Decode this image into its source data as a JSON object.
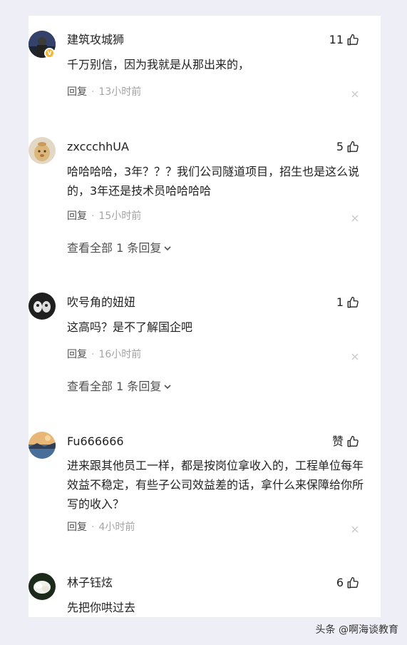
{
  "comments": [
    {
      "username": "建筑攻城狮",
      "likes": "11",
      "text": "千万别信，因为我就是从那出来的，",
      "reply_label": "回复",
      "separator": "·",
      "time": "13小时前",
      "badge": "V"
    },
    {
      "username": "zxccchhUA",
      "likes": "5",
      "text": "哈哈哈哈，3年？？？我们公司隧道项目，招生也是这么说的，3年还是技术员哈哈哈哈",
      "reply_label": "回复",
      "separator": "·",
      "time": "15小时前",
      "view_all": "查看全部 1 条回复"
    },
    {
      "username": "吹号角的妞妞",
      "likes": "1",
      "text": "这高吗？是不了解国企吧",
      "reply_label": "回复",
      "separator": "·",
      "time": "16小时前",
      "view_all": "查看全部 1 条回复"
    },
    {
      "username": "Fu666666",
      "likes": "赞",
      "text": "进来跟其他员工一样，都是按岗位拿收入的，工程单位每年效益不稳定，有些子公司效益差的话，拿什么来保障给你所写的收入？",
      "reply_label": "回复",
      "separator": "·",
      "time": "4小时前"
    },
    {
      "username": "林子钰炫",
      "likes": "6",
      "text": "先把你哄过去"
    }
  ],
  "watermark": "头条 @啊海谈教育",
  "colors": {
    "background": "#eeeef6",
    "panel": "#ffffff",
    "text": "#222222",
    "reply": "#505050",
    "time": "#a4a4a4"
  },
  "icons": {
    "like": "thumb-up-icon",
    "dismiss": "close-icon",
    "expand": "chevron-down-icon"
  }
}
